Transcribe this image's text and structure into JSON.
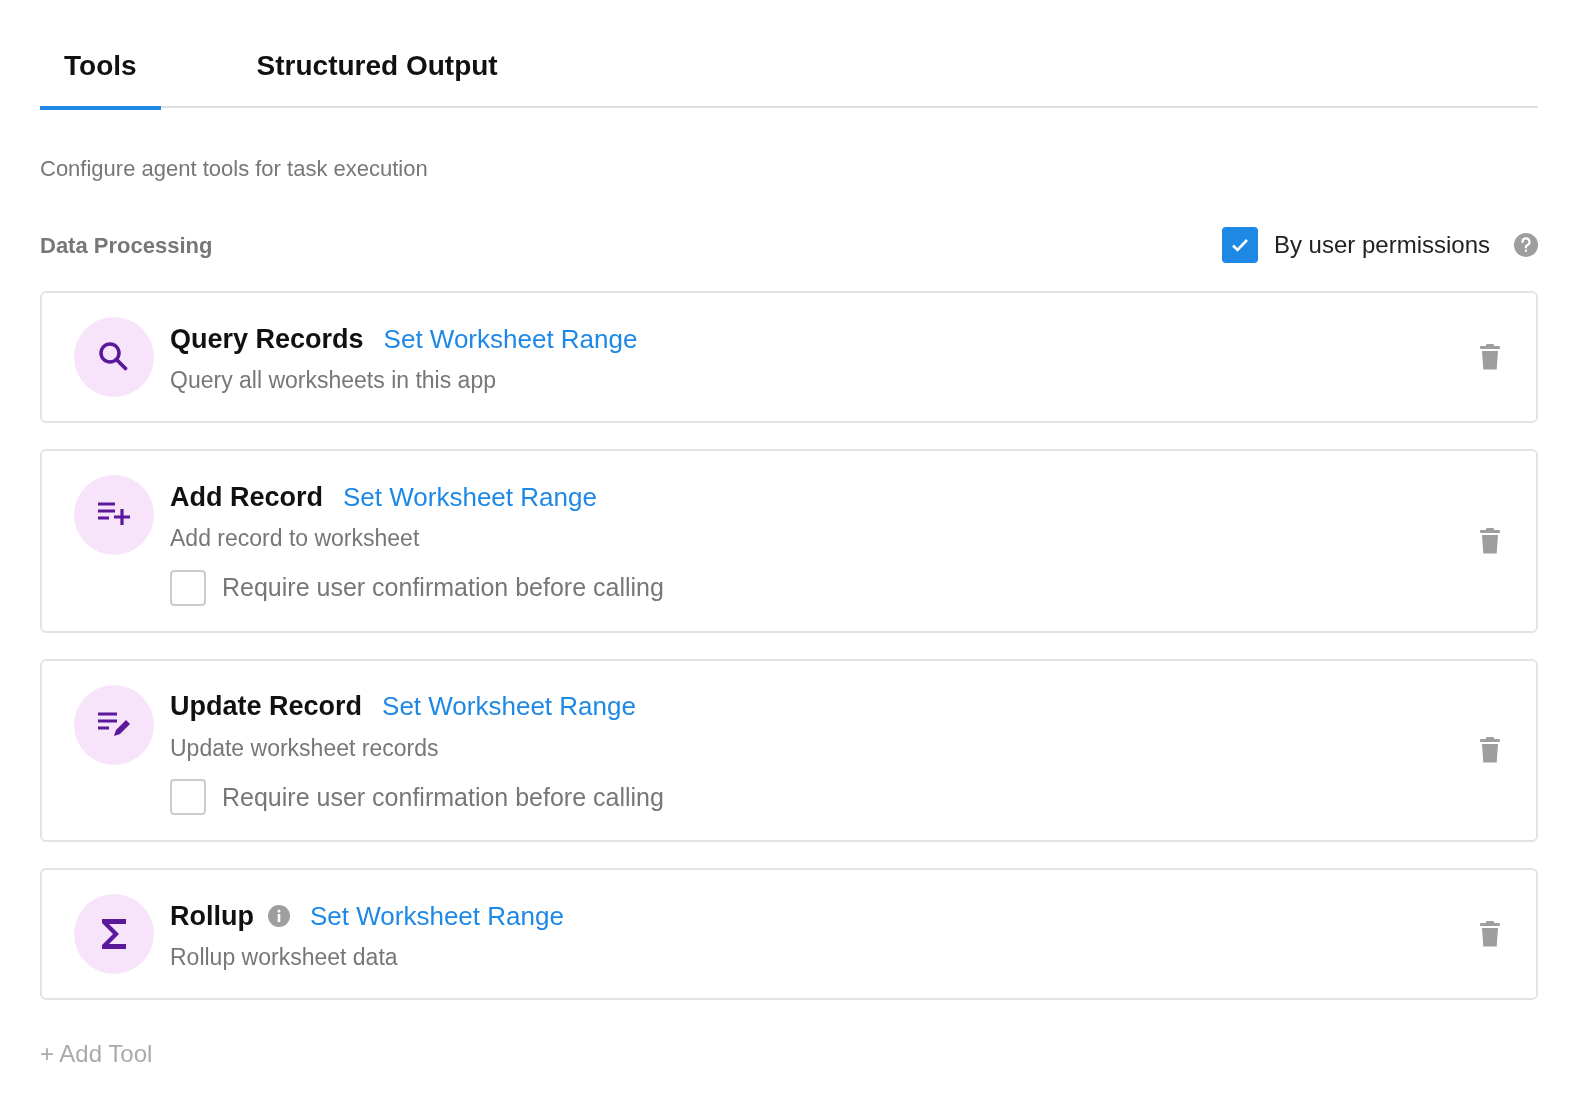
{
  "tabs": [
    {
      "label": "Tools",
      "selected": true
    },
    {
      "label": "Structured Output",
      "selected": false
    }
  ],
  "description": "Configure agent tools for task execution",
  "section": {
    "title": "Data Processing",
    "permissions": {
      "label": "By user permissions",
      "checked": true
    }
  },
  "tools": [
    {
      "kind": "query",
      "name": "Query Records",
      "info": false,
      "link": "Set Worksheet Range",
      "subtitle": "Query all worksheets in this app"
    },
    {
      "kind": "add",
      "name": "Add Record",
      "info": false,
      "link": "Set Worksheet Range",
      "subtitle": "Add record to worksheet",
      "confirmation": {
        "label": "Require user confirmation before calling",
        "checked": false
      }
    },
    {
      "kind": "update",
      "name": "Update Record",
      "info": false,
      "link": "Set Worksheet Range",
      "subtitle": "Update worksheet records",
      "confirmation": {
        "label": "Require user confirmation before calling",
        "checked": false
      }
    },
    {
      "kind": "rollup",
      "name": "Rollup",
      "info": true,
      "link": "Set Worksheet Range",
      "subtitle": "Rollup worksheet data"
    }
  ],
  "add_tool": "+ Add Tool"
}
